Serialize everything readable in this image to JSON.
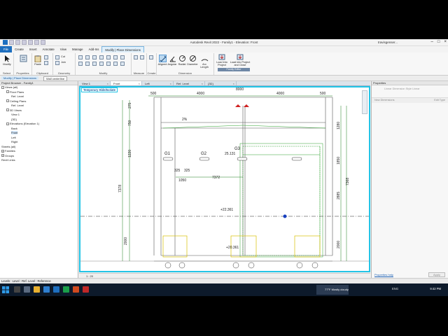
{
  "window": {
    "title": "Autodesk Revit 2022 - Family1 - Elevation: Front",
    "user": "travisgenser..."
  },
  "menu_tabs": [
    "File",
    "Create",
    "Insert",
    "Annotate",
    "View",
    "Manage",
    "Add-Ins",
    "Modify | Place Dimensions"
  ],
  "ribbon": {
    "groups": {
      "select": "Select",
      "properties": "Properties",
      "clipboard": "Clipboard",
      "geometry": "Geometry",
      "modify": "Modify",
      "view": "View",
      "measure": "Measure",
      "create": "Create",
      "dimension": "Dimension",
      "family_editor": "Family Editor"
    },
    "buttons": {
      "modify": "Modify",
      "paste": "Paste",
      "cut": "Cut",
      "join": "Join",
      "aligned": "Aligned",
      "angular": "Angular",
      "radial": "Radial",
      "diameter": "Diameter",
      "arc_length": "Arc Length",
      "load_into_project": "Load into Project",
      "load_into_project_close": "Load into Project and Close"
    }
  },
  "options_bar": {
    "label": "Modify | Place Dimensions",
    "select_value": "Wall centerline"
  },
  "project_browser": {
    "header": "Project Browser - Family1",
    "items": [
      {
        "label": "Views (all)",
        "level": 0,
        "exp": "-"
      },
      {
        "label": "Floor Plans",
        "level": 1,
        "exp": "-"
      },
      {
        "label": "Ref. Level",
        "level": 2,
        "exp": ""
      },
      {
        "label": "Ceiling Plans",
        "level": 1,
        "exp": "-"
      },
      {
        "label": "Ref. Level",
        "level": 2,
        "exp": ""
      },
      {
        "label": "3D Views",
        "level": 1,
        "exp": "-"
      },
      {
        "label": "View 1",
        "level": 2,
        "exp": ""
      },
      {
        "label": "{3D}",
        "level": 2,
        "exp": ""
      },
      {
        "label": "Elevations (Elevation 1)",
        "level": 1,
        "exp": "-"
      },
      {
        "label": "Back",
        "level": 2,
        "exp": ""
      },
      {
        "label": "Front",
        "level": 2,
        "exp": "",
        "selected": true
      },
      {
        "label": "Left",
        "level": 2,
        "exp": ""
      },
      {
        "label": "Right",
        "level": 2,
        "exp": ""
      },
      {
        "label": "Sheets (all)",
        "level": 0,
        "exp": ""
      },
      {
        "label": "Families",
        "level": 0,
        "exp": "+"
      },
      {
        "label": "Groups",
        "level": 0,
        "exp": "+"
      },
      {
        "label": "Revit Links",
        "level": 0,
        "exp": ""
      }
    ]
  },
  "view_tabs": [
    {
      "label": "View 1"
    },
    {
      "label": "Front",
      "active": true
    },
    {
      "label": "Left"
    },
    {
      "label": "Ref. Level"
    },
    {
      "label": "{3D}"
    }
  ],
  "canvas": {
    "banner": "Temporary Hide/Isolate",
    "scale": "1 : 20",
    "dimensions": {
      "d500_left": "500",
      "d4000_left": "4000",
      "d4000_right": "4000",
      "d500_right": "500",
      "top": "8000",
      "slope": "2%",
      "g1": "G1",
      "g2": "G2",
      "g3": "G3",
      "level_25131": "25.131",
      "d325a": "325",
      "d325b": "325",
      "d1050": "1050",
      "d7372": "7372",
      "level_22361": "+22.361",
      "level_20361": "+20.361",
      "left_2000": "2000",
      "left_7378": "7378",
      "left_1220": "1220",
      "left_750": "750",
      "left_275": "275",
      "right_1280": "1280",
      "right_1850": "1850",
      "right_2885": "2885",
      "right_7368": "7368",
      "right_2000": "2000"
    }
  },
  "properties": {
    "header": "Properties",
    "type_selector": "Linear Dimension Style Linear",
    "row_label": "New Dimensions",
    "row_value": "Edit Type",
    "help_link": "Properties help",
    "apply": "Apply"
  },
  "status": {
    "text": "Levels : Level : Ref. Level : Reference"
  },
  "taskbar": {
    "tray": "77°F  Mostly cloudy",
    "lang": "ENG",
    "clock": "9:42 PM"
  }
}
